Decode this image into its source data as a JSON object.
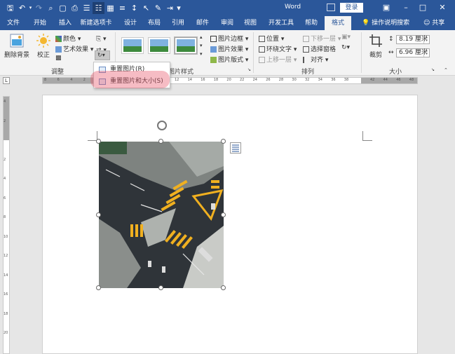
{
  "titlebar": {
    "title": "Word",
    "login": "登录",
    "qat_icons": [
      "save-icon",
      "undo-icon",
      "redo-icon",
      "print-preview-icon",
      "open-icon",
      "print-icon",
      "reading-mode-icon",
      "table-icon",
      "view-icon",
      "line-spacing-icon",
      "select-icon",
      "text-highlight-icon",
      "indent-icon",
      "more-icon"
    ]
  },
  "tabs": [
    "文件",
    "开始",
    "插入",
    "新建选项卡",
    "设计",
    "布局",
    "引用",
    "邮件",
    "审阅",
    "视图",
    "开发工具",
    "帮助",
    "格式"
  ],
  "active_tab": "格式",
  "tell_me": "操作说明搜索",
  "share": "共享",
  "ribbon": {
    "remove_bg": "删除背景",
    "correct": "校正",
    "color": "颜色",
    "art_effect": "艺术效果",
    "group_adjust": "调整",
    "picture_border": "图片边框",
    "picture_effect": "图片效果",
    "picture_layout": "图片版式",
    "group_picture_style": "图片样式",
    "position": "位置",
    "wrap_text": "环绕文字",
    "bring_forward": "上移一层",
    "send_backward": "下移一层",
    "selection_pane": "选择窗格",
    "align": "对齐",
    "group_arrange": "排列",
    "crop": "裁剪",
    "height": "8.19 厘米",
    "width": "6.96 厘米",
    "group_size": "大小"
  },
  "dropdown": {
    "item1": "重置图片(R)",
    "item2": "重置图片和大小(S)"
  },
  "ruler": {
    "h_ticks": [
      "8",
      "6",
      "4",
      "2",
      "",
      "2",
      "4",
      "6",
      "8",
      "10",
      "12",
      "14",
      "16",
      "18",
      "20",
      "22",
      "24",
      "26",
      "28",
      "30",
      "32",
      "34",
      "36",
      "38",
      "",
      "42",
      "44",
      "46",
      "48"
    ],
    "v_ticks": [
      "4",
      "2",
      "",
      "2",
      "4",
      "6",
      "8",
      "10",
      "12",
      "14",
      "16",
      "18",
      "20"
    ]
  },
  "colors": {
    "brand": "#2b579a",
    "highlight": "#e85064"
  }
}
